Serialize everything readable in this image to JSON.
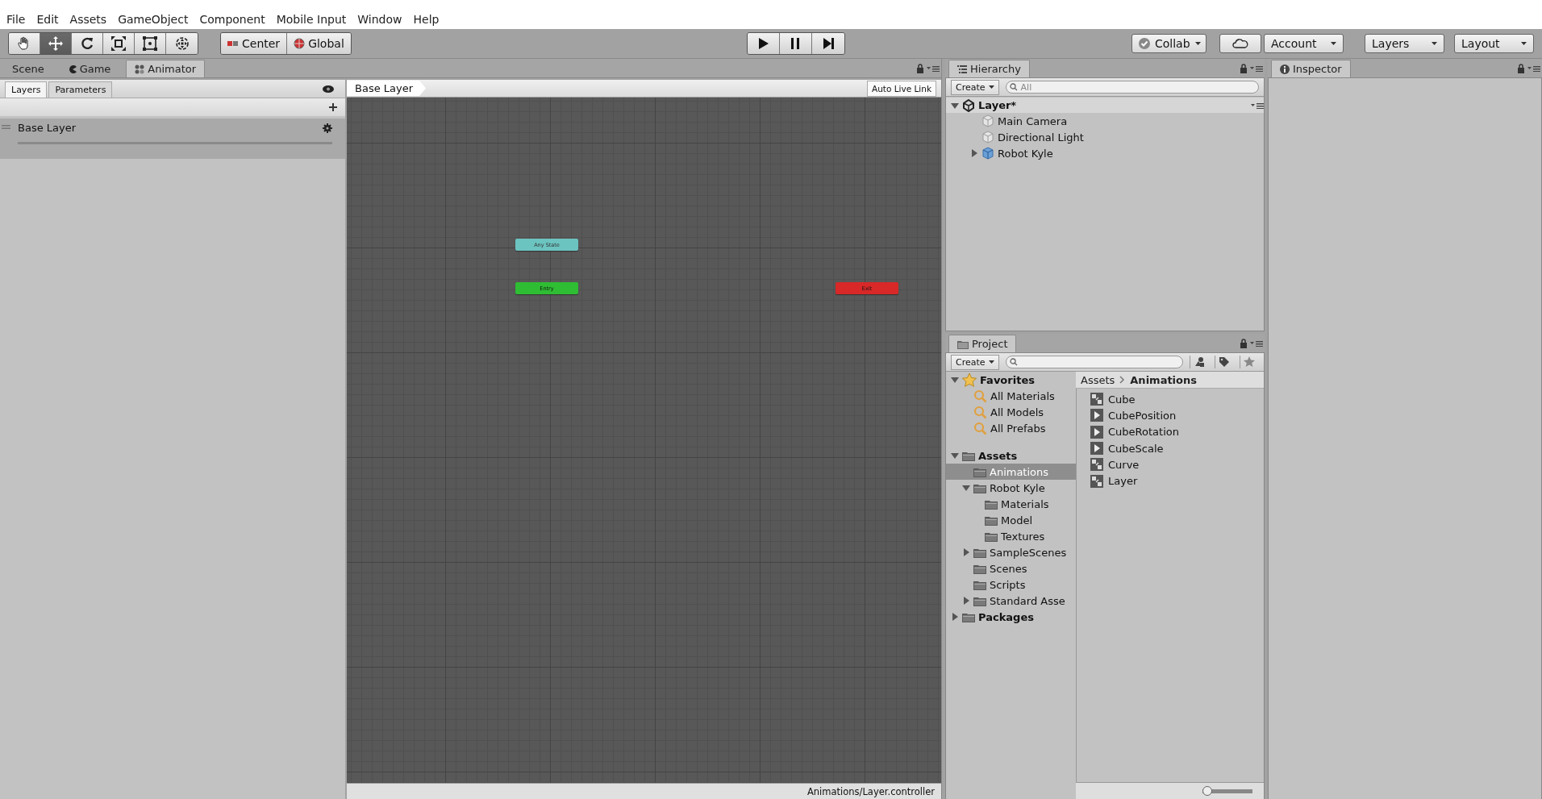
{
  "menu": [
    "File",
    "Edit",
    "Assets",
    "GameObject",
    "Component",
    "Mobile Input",
    "Window",
    "Help"
  ],
  "toolbar": {
    "tools": [
      {
        "kind": "hand",
        "selected": false
      },
      {
        "kind": "move",
        "selected": true
      },
      {
        "kind": "rotate",
        "selected": false
      },
      {
        "kind": "scale",
        "selected": false
      },
      {
        "kind": "rect",
        "selected": false
      },
      {
        "kind": "transform",
        "selected": false
      }
    ],
    "pivot": [
      {
        "label": "Center",
        "kind": "pivot"
      },
      {
        "label": "Global",
        "kind": "global"
      }
    ],
    "right": [
      {
        "label": "Collab",
        "kind": "collab"
      },
      {
        "kind": "cloud"
      },
      {
        "label": "Account",
        "kind": "dropdown"
      },
      {
        "label": "Layers",
        "kind": "dropdown"
      },
      {
        "label": "Layout",
        "kind": "dropdown"
      }
    ]
  },
  "tabs": [
    {
      "label": "Scene",
      "kind": "scene",
      "selected": false
    },
    {
      "label": "Game",
      "kind": "game",
      "selected": false
    },
    {
      "label": "Animator",
      "kind": "animator",
      "selected": true
    }
  ],
  "animator": {
    "side_tabs": [
      {
        "label": "Layers",
        "selected": true
      },
      {
        "label": "Parameters",
        "selected": false
      }
    ],
    "layers": [
      {
        "name": "Base Layer"
      }
    ],
    "breadcrumb": "Base Layer",
    "live_link": "Auto Live Link",
    "nodes": [
      {
        "label": "Any State",
        "kind": "any"
      },
      {
        "label": "Entry",
        "kind": "entry"
      },
      {
        "label": "Exit",
        "kind": "exit"
      }
    ],
    "status": "Animations/Layer.controller"
  },
  "hierarchy": {
    "tab": "Hierarchy",
    "create": "Create",
    "placeholder": "All",
    "items": [
      {
        "label": "Layer*",
        "kind": "scene",
        "expanded": true,
        "selected": false,
        "children": [
          {
            "label": "Main Camera",
            "kind": "object",
            "selected": false
          },
          {
            "label": "Directional Light",
            "kind": "object",
            "selected": false
          },
          {
            "label": "Robot Kyle",
            "kind": "prefab",
            "expanded": false,
            "selected": false
          }
        ]
      }
    ]
  },
  "project": {
    "tab": "Project",
    "create": "Create",
    "tree": [
      {
        "label": "Favorites",
        "kind": "favorites",
        "expanded": true,
        "selected": false,
        "children": [
          {
            "label": "All Materials",
            "kind": "search",
            "selected": false
          },
          {
            "label": "All Models",
            "kind": "search",
            "selected": false
          },
          {
            "label": "All Prefabs",
            "kind": "search",
            "selected": false
          }
        ]
      },
      {
        "label": "Assets",
        "kind": "folder",
        "expanded": true,
        "selected": false,
        "children": [
          {
            "label": "Animations",
            "kind": "folder",
            "selected": true
          },
          {
            "label": "Robot Kyle",
            "kind": "folder",
            "expanded": true,
            "selected": false,
            "children": [
              {
                "label": "Materials",
                "kind": "folder",
                "selected": false
              },
              {
                "label": "Model",
                "kind": "folder",
                "selected": false
              },
              {
                "label": "Textures",
                "kind": "folder",
                "selected": false
              }
            ]
          },
          {
            "label": "SampleScenes",
            "kind": "folder",
            "expanded": false,
            "selected": false
          },
          {
            "label": "Scenes",
            "kind": "folder",
            "selected": false
          },
          {
            "label": "Scripts",
            "kind": "folder",
            "selected": false
          },
          {
            "label": "Standard Asse",
            "kind": "folder",
            "expanded": false,
            "selected": false
          }
        ]
      },
      {
        "label": "Packages",
        "kind": "folder",
        "expanded": false,
        "selected": false
      }
    ],
    "path": [
      "Assets",
      "Animations"
    ],
    "files": [
      {
        "label": "Cube",
        "kind": "controller"
      },
      {
        "label": "CubePosition",
        "kind": "clip"
      },
      {
        "label": "CubeRotation",
        "kind": "clip"
      },
      {
        "label": "CubeScale",
        "kind": "clip"
      },
      {
        "label": "Curve",
        "kind": "controller"
      },
      {
        "label": "Layer",
        "kind": "controller"
      }
    ],
    "zoom": {
      "level": 0
    }
  },
  "inspector": {
    "tab": "Inspector"
  }
}
